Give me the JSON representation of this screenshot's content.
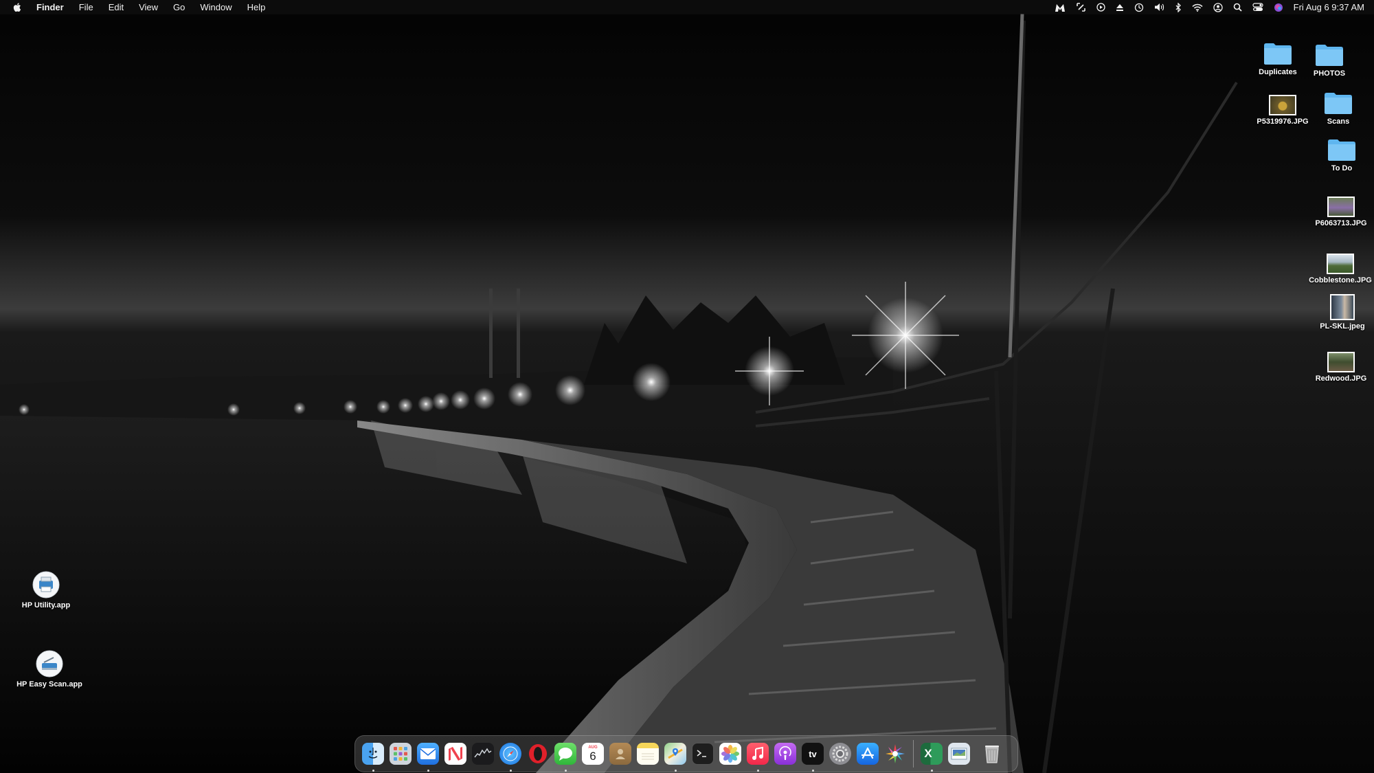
{
  "menubar": {
    "apple_icon": "apple-logo-icon",
    "app_name": "Finder",
    "menus": [
      "File",
      "Edit",
      "View",
      "Go",
      "Window",
      "Help"
    ],
    "status_icons": [
      "malwarebytes-icon",
      "screenshot-icon",
      "play-icon",
      "eject-icon",
      "time-machine-icon",
      "volume-icon",
      "bluetooth-icon",
      "wifi-icon",
      "user-icon",
      "search-icon",
      "control-center-icon",
      "siri-icon"
    ],
    "clock": "Fri Aug 6  9:37 AM"
  },
  "desktop": {
    "right_icons": [
      {
        "label": "Duplicates",
        "kind": "folder"
      },
      {
        "label": "PHOTOS",
        "kind": "folder"
      },
      {
        "label": "P5319976.JPG",
        "kind": "image"
      },
      {
        "label": "Scans",
        "kind": "folder"
      },
      {
        "label": "To Do",
        "kind": "folder"
      },
      {
        "label": "P6063713.JPG",
        "kind": "image"
      },
      {
        "label": "Cobblestone.JPG",
        "kind": "image"
      },
      {
        "label": "PL-SKL.jpeg",
        "kind": "image"
      },
      {
        "label": "Redwood.JPG",
        "kind": "image"
      }
    ],
    "left_icons": [
      {
        "label": "HP Utility.app",
        "kind": "app"
      },
      {
        "label": "HP Easy Scan.app",
        "kind": "app"
      }
    ]
  },
  "dock": {
    "items": [
      {
        "name": "finder-icon",
        "running": true
      },
      {
        "name": "launchpad-icon",
        "running": false
      },
      {
        "name": "mail-icon",
        "running": true
      },
      {
        "name": "news-icon",
        "running": false
      },
      {
        "name": "stocks-icon",
        "running": false
      },
      {
        "name": "safari-icon",
        "running": true
      },
      {
        "name": "opera-icon",
        "running": false
      },
      {
        "name": "messages-icon",
        "running": true
      },
      {
        "name": "calendar-icon",
        "running": false,
        "month": "AUG",
        "day": "6"
      },
      {
        "name": "contacts-icon",
        "running": false
      },
      {
        "name": "notes-icon",
        "running": false
      },
      {
        "name": "maps-icon",
        "running": true
      },
      {
        "name": "terminal-icon",
        "running": false
      },
      {
        "name": "photos-icon",
        "running": false
      },
      {
        "name": "music-icon",
        "running": true
      },
      {
        "name": "podcasts-icon",
        "running": false
      },
      {
        "name": "apple-tv-icon",
        "running": true,
        "text": "tv"
      },
      {
        "name": "system-preferences-icon",
        "running": false
      },
      {
        "name": "app-store-icon",
        "running": false
      },
      {
        "name": "photo-app-icon",
        "running": false
      },
      {
        "name": "excel-icon",
        "running": true,
        "text": "X"
      },
      {
        "name": "preview-icon",
        "running": false
      },
      {
        "name": "trash-icon",
        "running": false
      }
    ]
  }
}
